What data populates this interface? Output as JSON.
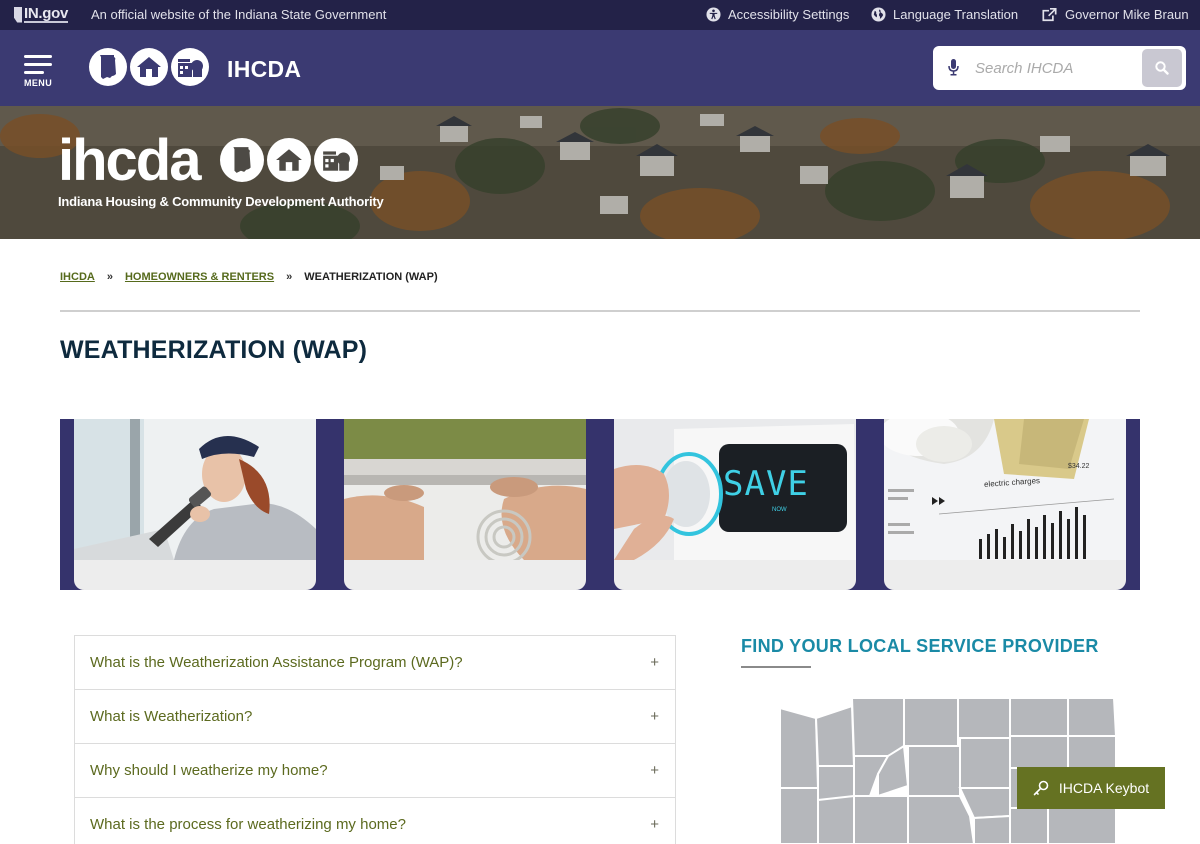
{
  "topbar": {
    "logo_text": "IN.gov",
    "official_text": "An official website of the Indiana State Government",
    "accessibility_label": "Accessibility Settings",
    "translation_label": "Language Translation",
    "governor_label": "Governor Mike Braun",
    "icons": [
      "accessibility-icon",
      "globe-icon",
      "external-link-icon"
    ]
  },
  "header": {
    "menu_label": "MENU",
    "site_name": "IHCDA",
    "search_placeholder": "Search IHCDA"
  },
  "hero": {
    "wordmark": "ihcda",
    "subtitle": "Indiana Housing & Community Development Authority"
  },
  "breadcrumb": {
    "items": [
      "IHCDA",
      "HOMEOWNERS & RENTERS"
    ],
    "separator": "»",
    "current": "WEATHERIZATION (WAP)"
  },
  "page": {
    "title": "WEATHERIZATION (WAP)"
  },
  "cards": {
    "thermostat_text": "SAVE",
    "thermostat_sub": "NOW",
    "bill_text": "electric charges",
    "bill_amount": "$34.22"
  },
  "accordion": {
    "items": [
      "What is the Weatherization Assistance Program (WAP)?",
      "What is Weatherization?",
      "Why should I weatherize my home?",
      "What is the process for weatherizing my home?"
    ],
    "expand_symbol": "+"
  },
  "provider": {
    "title": "FIND YOUR LOCAL SERVICE PROVIDER"
  },
  "keybot": {
    "label": "IHCDA Keybot"
  },
  "colors": {
    "topbar": "#232248",
    "header": "#3b3a72",
    "link_green": "#566a1c",
    "title_navy": "#0e2a3e",
    "teal": "#1a8aa6",
    "keybot": "#657222",
    "map_gray": "#b5b7bb"
  }
}
